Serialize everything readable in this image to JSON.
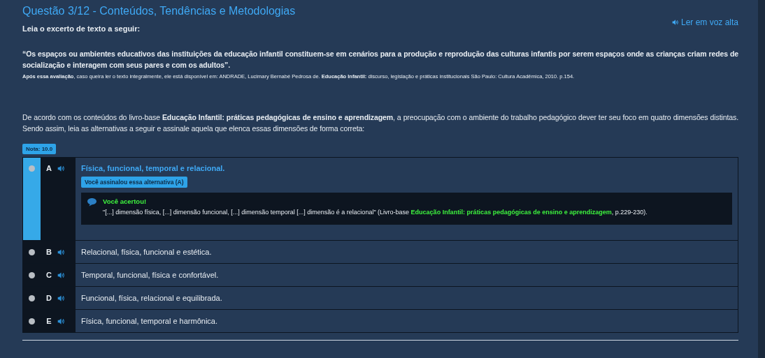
{
  "title": "Questão 3/12 - Conteúdos, Tendências e Metodologias",
  "read_aloud": "Ler em voz alta",
  "intro": "Leia o excerto de texto a seguir:",
  "quote": "“Os espaços ou ambientes educativos das instituições da educação infantil constituem-se em cenários para a produção e reprodução das culturas infantis por serem espaços onde as crianças criam redes de socialização e interagem com seus pares e com os adultos”.",
  "source": "**Após essa avaliação**, caso queira ler o texto integralmente, ele está disponível em: ANDRADE, Lucimary Bernabé Pedrosa de. **Educação Infantil:** discurso, legislação e práticas institucionais São Paulo: Cultura Acadêmica, 2010. p.154.",
  "question": "De acordo com os conteúdos do livro-base **Educação Infantil: práticas pedagógicas de ensino e aprendizagem**, a preocupação com o ambiente do trabalho pedagógico dever ter seu foco em quatro dimensões distintas. Sendo assim, leia as alternativas a seguir e assinale aquela que elenca essas dimensões de forma correta:",
  "grade": "Nota: 10.0",
  "options": [
    {
      "letter": "A",
      "text": "Física, funcional, temporal e relacional.",
      "selected": true,
      "marked_label": "Você assinalou essa alternativa (A)",
      "feedback": {
        "title": "Você acertou!",
        "text_before": "\"[...] dimensão física, [...] dimensão funcional, [...] dimensão temporal [...] dimensão é a relacional\" (Livro-base ",
        "highlight": "Educação Infantil: práticas pedagógicas de ensino e aprendizagem",
        "text_after": ", p.229-230)."
      }
    },
    {
      "letter": "B",
      "text": "Relacional, física, funcional e estética.",
      "selected": false
    },
    {
      "letter": "C",
      "text": "Temporal, funcional, física e confortável.",
      "selected": false
    },
    {
      "letter": "D",
      "text": "Funcional, física, relacional e equilibrada.",
      "selected": false
    },
    {
      "letter": "E",
      "text": "Física, funcional, temporal e harmônica.",
      "selected": false
    }
  ]
}
